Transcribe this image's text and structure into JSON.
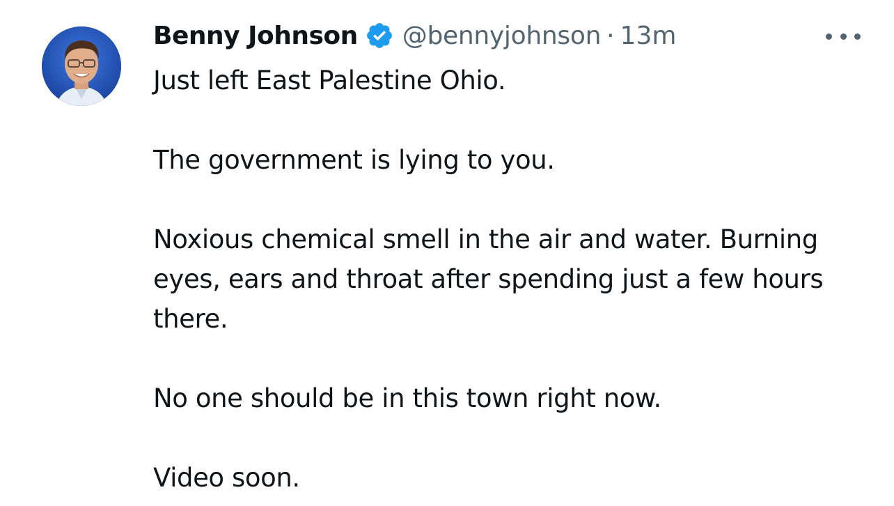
{
  "author": {
    "display_name": "Benny Johnson",
    "handle": "@bennyjohnson",
    "separator": "·",
    "time_ago": "13m",
    "verified_color": "#1d9bf0"
  },
  "tweet": {
    "paragraphs": [
      "Just left East Palestine Ohio.",
      "The government is lying to you.",
      "Noxious chemical smell in the air and water. Burning eyes, ears and throat after spending just a few hours there.",
      "No one should be in this town right now.",
      "Video soon."
    ]
  },
  "icons": {
    "avatar": "avatar",
    "verified": "verified-badge-icon",
    "more": "more-options-icon"
  }
}
